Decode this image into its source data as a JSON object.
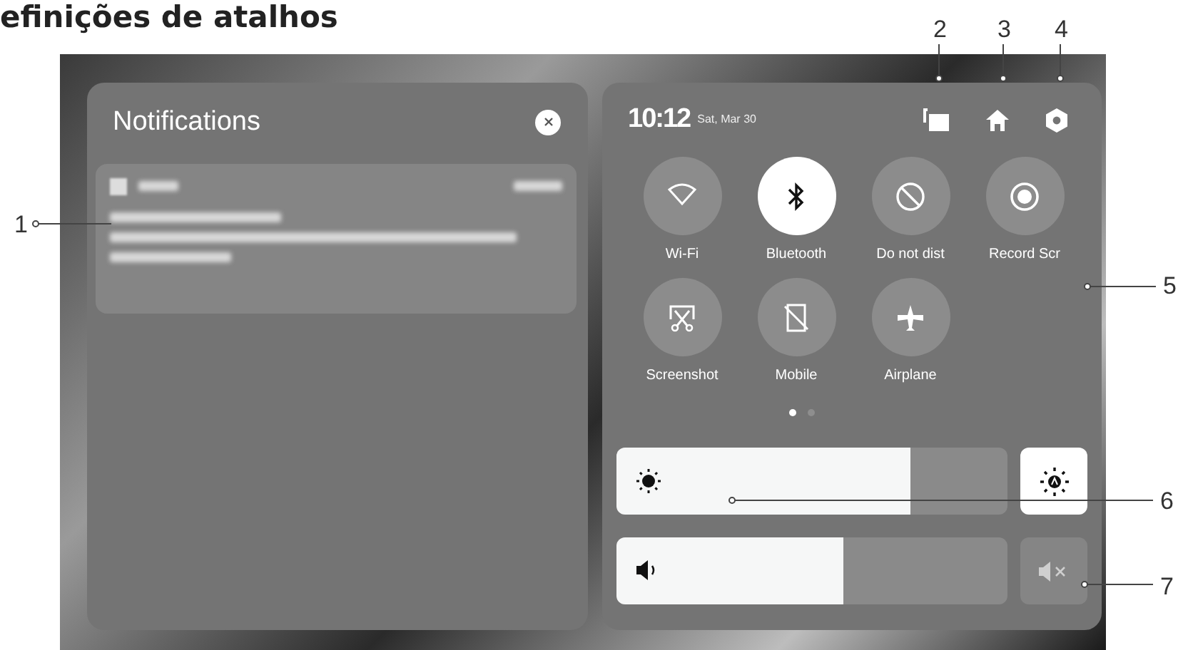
{
  "heading": "efinições de atalhos",
  "notifications": {
    "title": "Notifications"
  },
  "quick_settings": {
    "time": "10:12",
    "date": "Sat, Mar 30",
    "tiles": [
      {
        "label": "Wi-Fi",
        "on": false
      },
      {
        "label": "Bluetooth",
        "on": true
      },
      {
        "label": "Do not dist",
        "on": false
      },
      {
        "label": "Record Scr",
        "on": false
      },
      {
        "label": "Screenshot",
        "on": false
      },
      {
        "label": "Mobile",
        "on": false
      },
      {
        "label": "Airplane",
        "on": false
      }
    ],
    "pages": [
      {
        "selected": true
      },
      {
        "selected": false
      }
    ],
    "brightness": {
      "level": 0.75,
      "auto": true
    },
    "volume": {
      "level": 0.58,
      "muted": false
    }
  },
  "callouts": [
    "1",
    "2",
    "3",
    "4",
    "5",
    "6",
    "7"
  ]
}
